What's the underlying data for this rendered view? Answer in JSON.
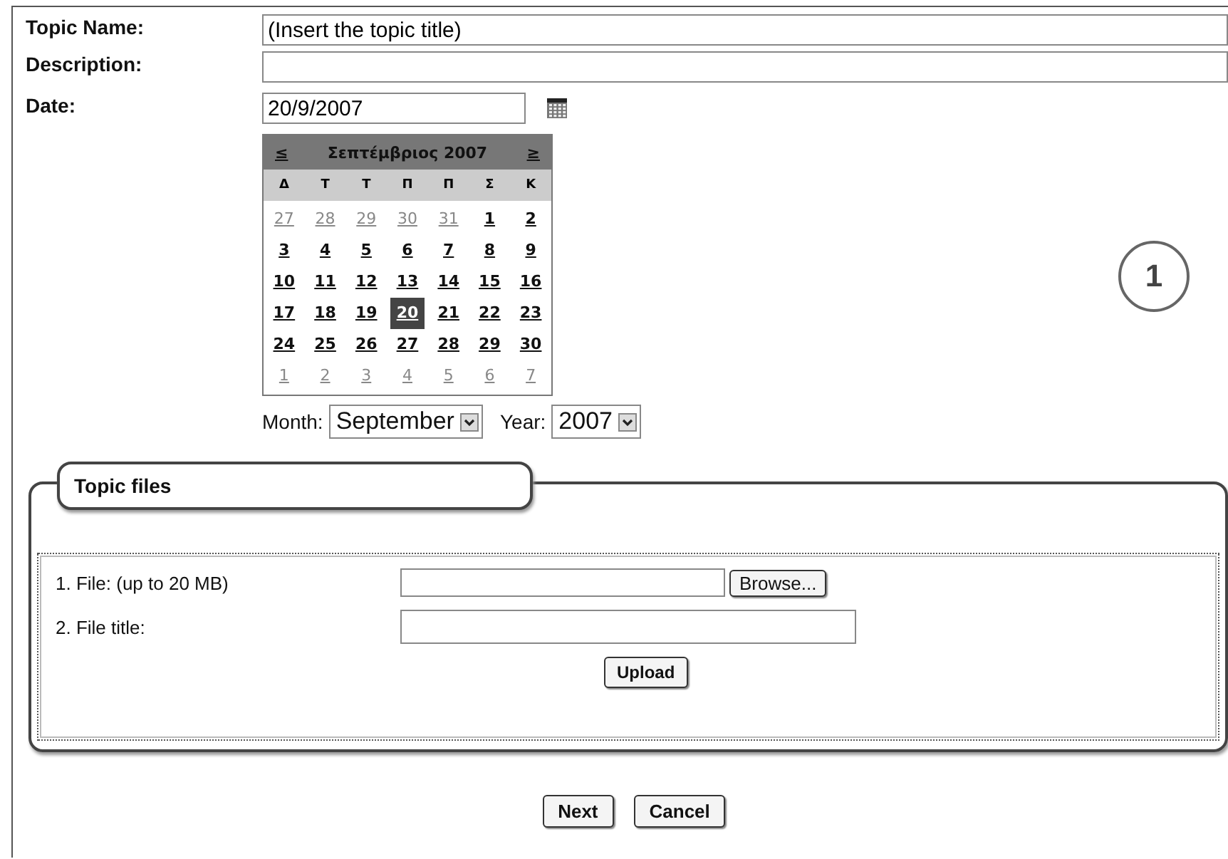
{
  "fields": [
    {
      "label": "Topic Name:",
      "value": "(Insert the topic title)"
    },
    {
      "label": "Description:"
    }
  ],
  "date": {
    "label": "Date:",
    "value": "20/9/2007"
  },
  "calendar": {
    "prev": "≤",
    "title": "Σεπτέμβριος 2007",
    "next": "≥",
    "weekdays": [
      "Δ",
      "Τ",
      "Τ",
      "Π",
      "Π",
      "Σ",
      "Κ"
    ],
    "weeks": [
      [
        {
          "day": "27",
          "other_month": true,
          "selected": false
        },
        {
          "day": "28",
          "other_month": true,
          "selected": false
        },
        {
          "day": "29",
          "other_month": true,
          "selected": false
        },
        {
          "day": "30",
          "other_month": true,
          "selected": false
        },
        {
          "day": "31",
          "other_month": true,
          "selected": false
        },
        {
          "day": "1",
          "other_month": false,
          "selected": false
        },
        {
          "day": "2",
          "other_month": false,
          "selected": false
        }
      ],
      [
        {
          "day": "3",
          "other_month": false,
          "selected": false
        },
        {
          "day": "4",
          "other_month": false,
          "selected": false
        },
        {
          "day": "5",
          "other_month": false,
          "selected": false
        },
        {
          "day": "6",
          "other_month": false,
          "selected": false
        },
        {
          "day": "7",
          "other_month": false,
          "selected": false
        },
        {
          "day": "8",
          "other_month": false,
          "selected": false
        },
        {
          "day": "9",
          "other_month": false,
          "selected": false
        }
      ],
      [
        {
          "day": "10",
          "other_month": false,
          "selected": false
        },
        {
          "day": "11",
          "other_month": false,
          "selected": false
        },
        {
          "day": "12",
          "other_month": false,
          "selected": false
        },
        {
          "day": "13",
          "other_month": false,
          "selected": false
        },
        {
          "day": "14",
          "other_month": false,
          "selected": false
        },
        {
          "day": "15",
          "other_month": false,
          "selected": false
        },
        {
          "day": "16",
          "other_month": false,
          "selected": false
        }
      ],
      [
        {
          "day": "17",
          "other_month": false,
          "selected": false
        },
        {
          "day": "18",
          "other_month": false,
          "selected": false
        },
        {
          "day": "19",
          "other_month": false,
          "selected": false
        },
        {
          "day": "20",
          "other_month": false,
          "selected": true
        },
        {
          "day": "21",
          "other_month": false,
          "selected": false
        },
        {
          "day": "22",
          "other_month": false,
          "selected": false
        },
        {
          "day": "23",
          "other_month": false,
          "selected": false
        }
      ],
      [
        {
          "day": "24",
          "other_month": false,
          "selected": false
        },
        {
          "day": "25",
          "other_month": false,
          "selected": false
        },
        {
          "day": "26",
          "other_month": false,
          "selected": false
        },
        {
          "day": "27",
          "other_month": false,
          "selected": false
        },
        {
          "day": "28",
          "other_month": false,
          "selected": false
        },
        {
          "day": "29",
          "other_month": false,
          "selected": false
        },
        {
          "day": "30",
          "other_month": false,
          "selected": false
        }
      ],
      [
        {
          "day": "1",
          "other_month": true,
          "selected": false
        },
        {
          "day": "2",
          "other_month": true,
          "selected": false
        },
        {
          "day": "3",
          "other_month": true,
          "selected": false
        },
        {
          "day": "4",
          "other_month": true,
          "selected": false
        },
        {
          "day": "5",
          "other_month": true,
          "selected": false
        },
        {
          "day": "6",
          "other_month": true,
          "selected": false
        },
        {
          "day": "7",
          "other_month": true,
          "selected": false
        }
      ]
    ],
    "month_label": "Month:",
    "month": "September",
    "year_label": "Year:",
    "year": "2007"
  },
  "step_badge": "1",
  "topic_files": {
    "legend": "Topic files",
    "file_label": "1. File: (up to 20 MB)",
    "browse_button": "Browse...",
    "title_label": "2. File title:",
    "upload_button": "Upload"
  },
  "buttons": [
    "Next",
    "Cancel"
  ]
}
